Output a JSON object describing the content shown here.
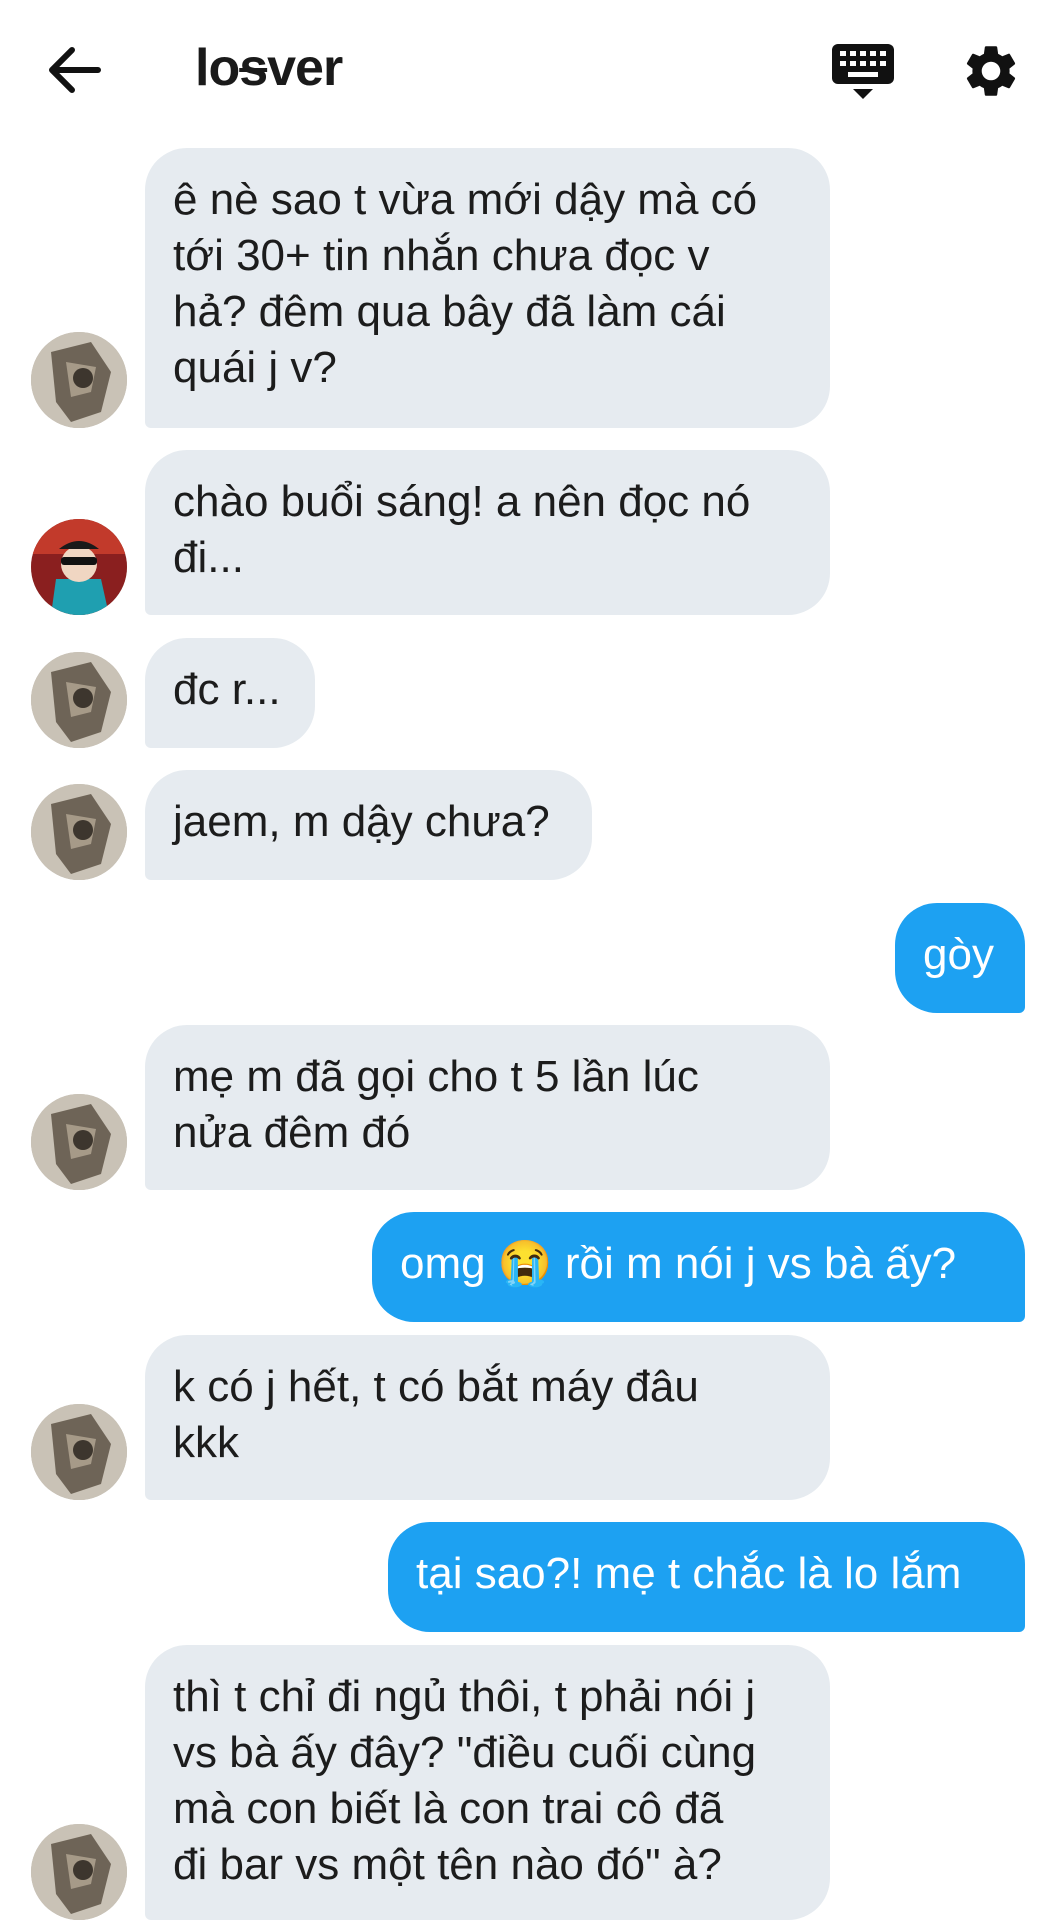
{
  "header": {
    "title_pre": "lo",
    "title_strike": "s",
    "title_post": "ver",
    "back_icon": "arrow-left-icon",
    "keyboard_icon": "keyboard-icon",
    "settings_icon": "gear-icon"
  },
  "colors": {
    "incoming_bubble": "#e6ebf0",
    "outgoing_bubble": "#1da1f2",
    "text": "#1c1c1c"
  },
  "messages": [
    {
      "dir": "in",
      "avatar": "user-a",
      "text": "ê nè sao t vừa mới dậy mà có\ntới 30+ tin nhắn chưa đọc v\nhả? đêm qua bây đã làm cái\nquái j v?"
    },
    {
      "dir": "in",
      "avatar": "user-b",
      "text": "chào buổi sáng! a nên đọc nó\nđi..."
    },
    {
      "dir": "in",
      "avatar": "user-a",
      "text": "đc r..."
    },
    {
      "dir": "in",
      "avatar": "user-a",
      "text": "jaem, m dậy chưa?"
    },
    {
      "dir": "out",
      "text": "gòy"
    },
    {
      "dir": "in",
      "avatar": "user-a",
      "text": "mẹ m đã gọi cho t 5 lần lúc\nnửa đêm đó"
    },
    {
      "dir": "out",
      "text": "omg 😭 rồi m nói j vs bà ấy?"
    },
    {
      "dir": "in",
      "avatar": "user-a",
      "text": "k có j hết, t có bắt máy đâu\nkkk"
    },
    {
      "dir": "out",
      "text": "tại sao?! mẹ t chắc là lo lắm"
    },
    {
      "dir": "in",
      "avatar": "user-a",
      "text": "thì t chỉ đi ngủ thôi, t phải nói j\nvs bà ấy đây? \"điều cuối cùng\nmà con biết là con trai cô đã\nđi bar vs một tên nào đó\" à?"
    }
  ]
}
